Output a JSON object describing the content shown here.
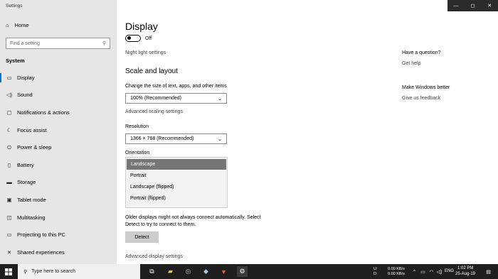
{
  "window": {
    "title": "Settings",
    "controls": {
      "minimize": "—",
      "maximize": "◻",
      "close": "✕"
    }
  },
  "sidebar": {
    "home_label": "Home",
    "search_placeholder": "Find a setting",
    "section_label": "System",
    "items": [
      {
        "label": "Display",
        "icon": "monitor-icon",
        "glyph": "▭",
        "active": true
      },
      {
        "label": "Sound",
        "icon": "speaker-icon",
        "glyph": "◁)"
      },
      {
        "label": "Notifications & actions",
        "icon": "notifications-icon",
        "glyph": "▢"
      },
      {
        "label": "Focus assist",
        "icon": "moon-icon",
        "glyph": "☾"
      },
      {
        "label": "Power & sleep",
        "icon": "power-icon",
        "glyph": "⏻"
      },
      {
        "label": "Battery",
        "icon": "battery-icon",
        "glyph": "▯"
      },
      {
        "label": "Storage",
        "icon": "storage-icon",
        "glyph": "▬"
      },
      {
        "label": "Tablet mode",
        "icon": "tablet-icon",
        "glyph": "▣"
      },
      {
        "label": "Multitasking",
        "icon": "multitasking-icon",
        "glyph": "◫"
      },
      {
        "label": "Projecting to this PC",
        "icon": "projecting-icon",
        "glyph": "▭"
      },
      {
        "label": "Shared experiences",
        "icon": "shared-icon",
        "glyph": "✕"
      }
    ]
  },
  "main": {
    "title": "Display",
    "night_light_state": "Off",
    "night_light_settings": "Night light settings",
    "scale_heading": "Scale and layout",
    "scale_label": "Change the size of text, apps, and other items",
    "scale_value": "100% (Recommended)",
    "advanced_scaling": "Advanced scaling settings",
    "resolution_label": "Resolution",
    "resolution_value": "1366 × 768 (Recommended)",
    "orientation_label": "Orientation",
    "orientation_options": [
      "Landscape",
      "Portrait",
      "Landscape (flipped)",
      "Portrait (flipped)"
    ],
    "orientation_selected": "Landscape",
    "older_displays_line1": "Older displays might not always connect automatically. Select",
    "older_displays_line2": "Detect to try to connect to them.",
    "detect_button": "Detect",
    "advanced_display": "Advanced display settings"
  },
  "right_panel": {
    "question_heading": "Have a question?",
    "get_help": "Get help",
    "better_heading": "Make Windows better",
    "feedback": "Give us feedback"
  },
  "taskbar": {
    "search_placeholder": "Type here to search",
    "net_up": "0.00 KB/s",
    "net_down": "0.00 KB/s",
    "net_labels": [
      "U:",
      "D:"
    ],
    "language": "ENG",
    "time": "1:02 PM",
    "date": "25-Aug-19",
    "colors": {
      "background": "#1f1f1f",
      "accent": "#0078d7"
    }
  }
}
